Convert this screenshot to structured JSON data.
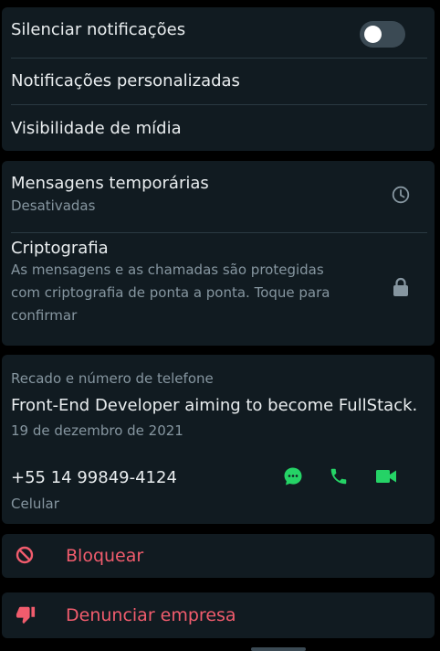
{
  "notifications": {
    "mute_label": "Silenciar notificações",
    "mute_on": false,
    "custom_label": "Notificações personalizadas",
    "media_label": "Visibilidade de mídia"
  },
  "privacy": {
    "temp_title": "Mensagens temporárias",
    "temp_status": "Desativadas",
    "crypto_title": "Criptografia",
    "crypto_line1": "As mensagens e as chamadas são protegidas",
    "crypto_line2": "com criptografia de ponta a ponta. Toque para",
    "crypto_line3": "confirmar"
  },
  "about": {
    "section_label": "Recado e número de telefone",
    "status_text": "Front-End Developer aiming to become FullStack.",
    "status_date": "19 de dezembro de 2021",
    "phone": "+55 14 99849-4124",
    "phone_type": "Celular"
  },
  "actions": {
    "block_label": "Bloquear",
    "report_label": "Denunciar empresa"
  },
  "colors": {
    "accent_green": "#25d366",
    "danger_red": "#f15c6d",
    "panel": "#111b21"
  }
}
